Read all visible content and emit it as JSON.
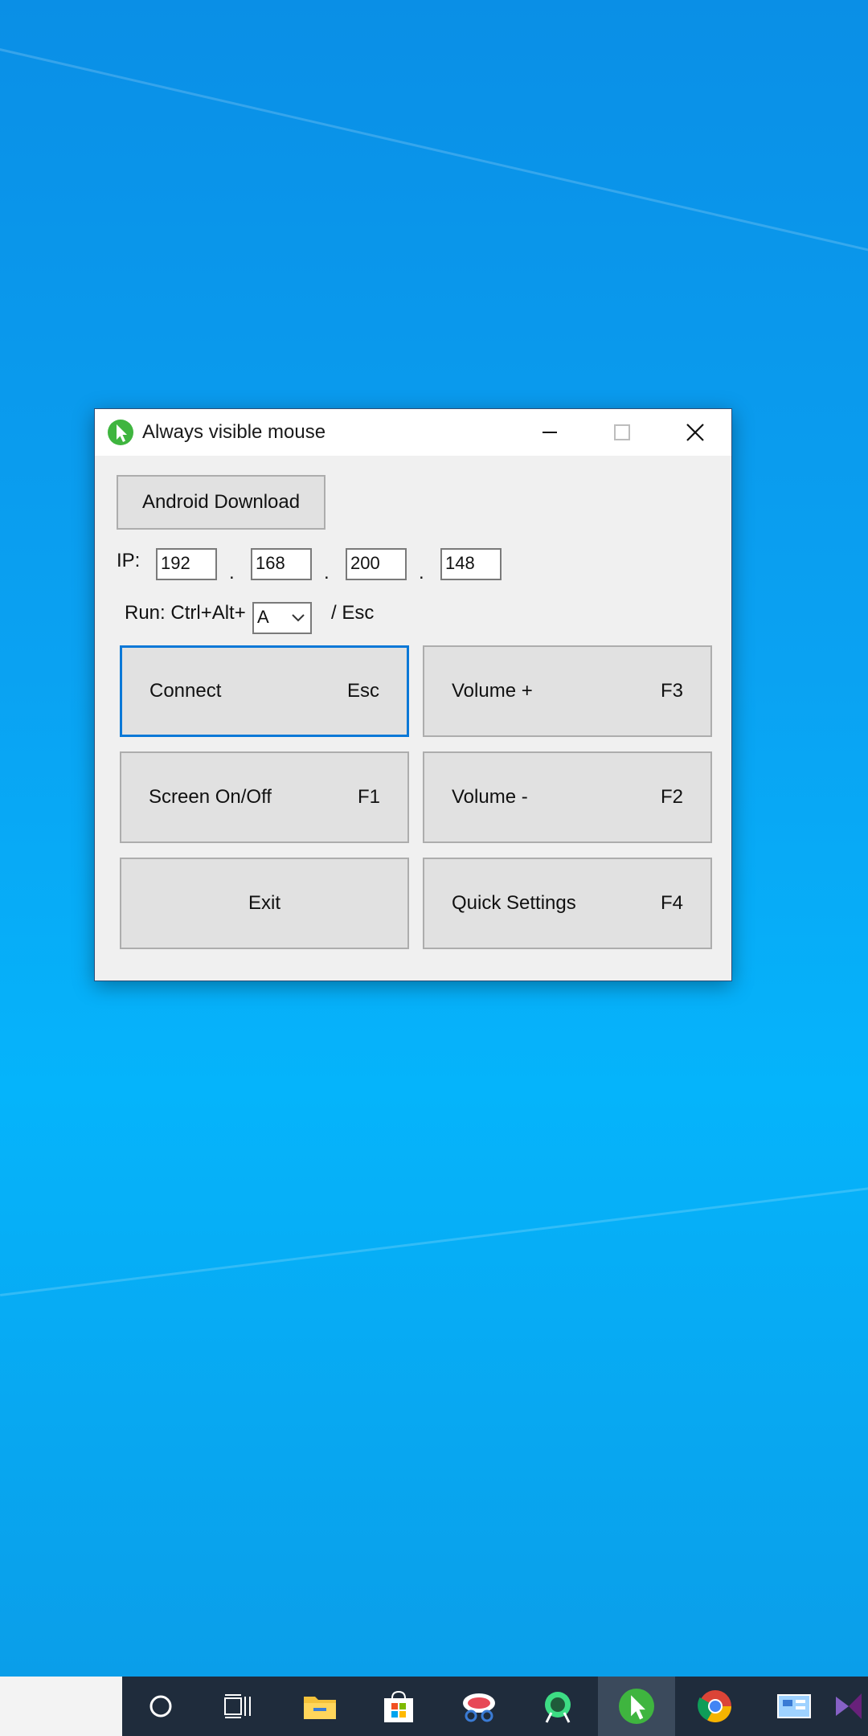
{
  "window": {
    "title": "Always visible mouse",
    "android_download_label": "Android Download",
    "ip": {
      "label": "IP:",
      "octets": [
        "192",
        "168",
        "200",
        "148"
      ],
      "separator": "."
    },
    "run": {
      "label": "Run: Ctrl+Alt+",
      "key_selected": "A",
      "suffix": "/ Esc"
    },
    "buttons": {
      "connect": {
        "label": "Connect",
        "shortcut": "Esc"
      },
      "volume_up": {
        "label": "Volume +",
        "shortcut": "F3"
      },
      "screen_toggle": {
        "label": "Screen On/Off",
        "shortcut": "F1"
      },
      "volume_down": {
        "label": "Volume -",
        "shortcut": "F2"
      },
      "exit": {
        "label": "Exit"
      },
      "quick_settings": {
        "label": "Quick Settings",
        "shortcut": "F4"
      }
    }
  },
  "taskbar": {
    "icons": [
      "cortana-icon",
      "task-view-icon",
      "file-explorer-icon",
      "store-icon",
      "snip-icon",
      "android-studio-icon",
      "always-visible-mouse-icon",
      "chrome-icon",
      "control-panel-icon",
      "visual-studio-icon"
    ],
    "active_icon": "always-visible-mouse-icon"
  },
  "colors": {
    "desktop": "#0aa2f2",
    "accent": "#0a78d7",
    "app_icon": "#3fb53f",
    "taskbar": "#1f2c3c"
  }
}
